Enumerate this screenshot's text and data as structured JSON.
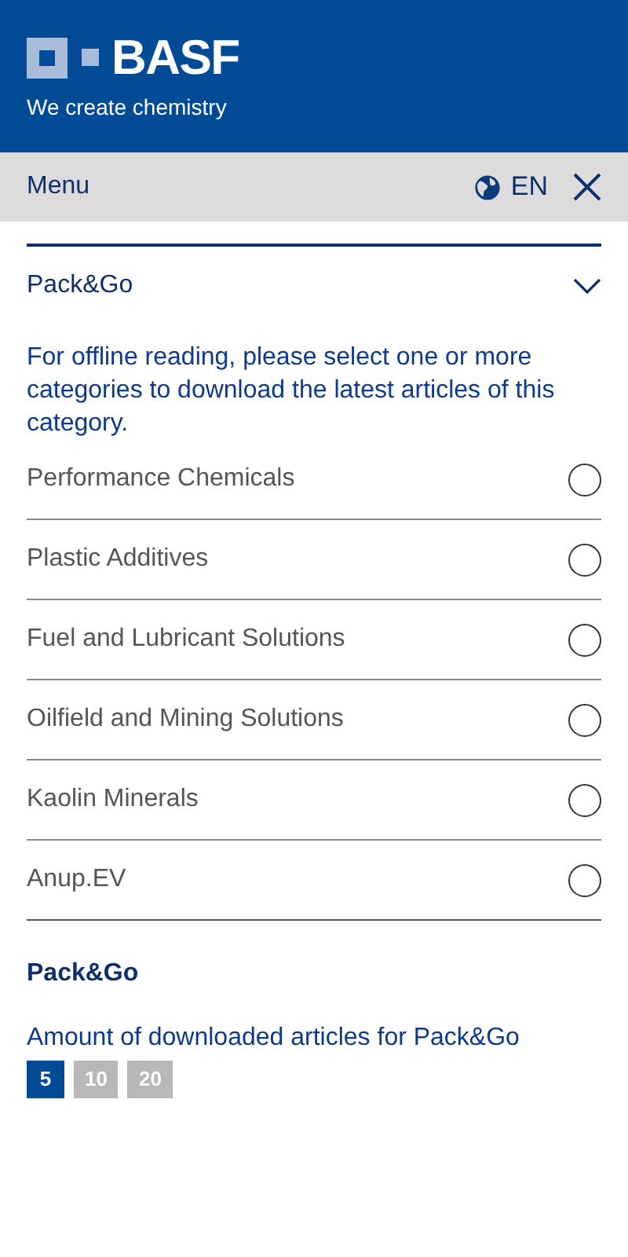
{
  "header": {
    "brand": "BASF",
    "tagline": "We create chemistry"
  },
  "menu_bar": {
    "title": "Menu",
    "language": "EN"
  },
  "section": {
    "title": "Pack&Go",
    "expanded": true,
    "description": "For offline reading, please select one or more categories to download the latest articles of this category.",
    "categories": [
      {
        "label": "Performance Chemicals",
        "selected": false
      },
      {
        "label": "Plastic Additives",
        "selected": false
      },
      {
        "label": "Fuel and Lubricant Solutions",
        "selected": false
      },
      {
        "label": "Oilfield and Mining Solutions",
        "selected": false
      },
      {
        "label": "Kaolin Minerals",
        "selected": false
      },
      {
        "label": "Anup.EV",
        "selected": false
      }
    ]
  },
  "settings": {
    "title": "Pack&Go",
    "label": "Amount of downloaded articles for Pack&Go",
    "options": [
      {
        "label": "5",
        "selected": true
      },
      {
        "label": "10",
        "selected": false
      },
      {
        "label": "20",
        "selected": false
      }
    ]
  }
}
